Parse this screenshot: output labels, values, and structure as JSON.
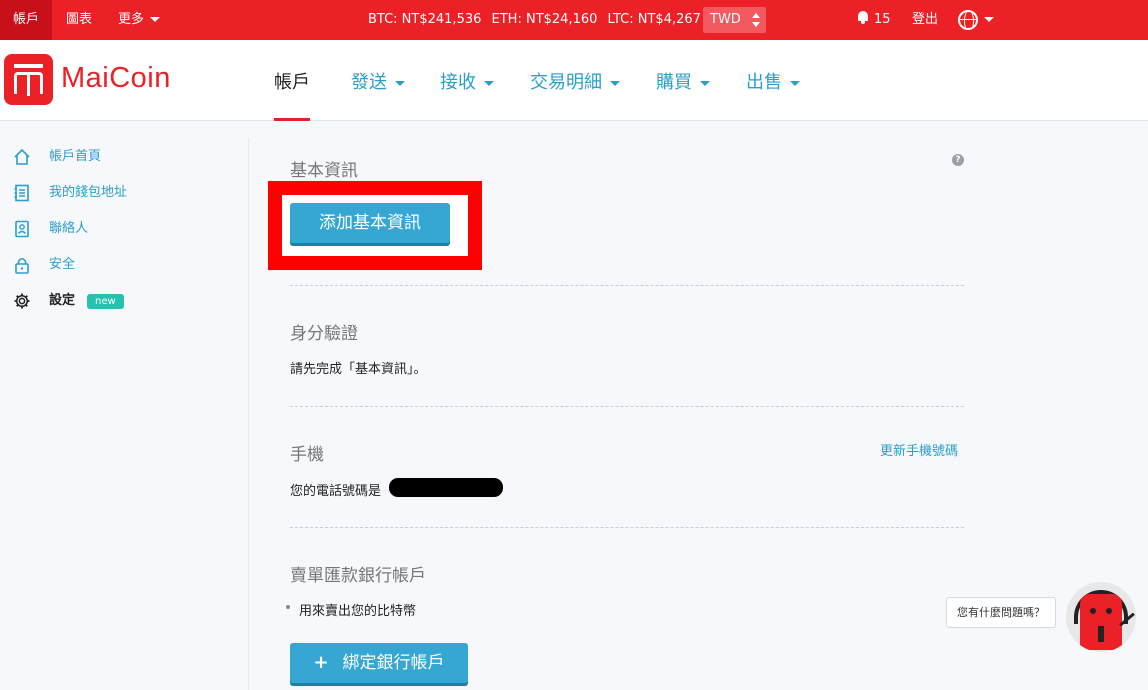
{
  "topbar": {
    "account": "帳戶",
    "chart": "圖表",
    "more": "更多",
    "prices": {
      "btc": "BTC: NT$241,536",
      "eth": "ETH: NT$24,160",
      "ltc": "LTC: NT$4,267"
    },
    "currency": "TWD",
    "notifications": "15",
    "logout": "登出",
    "icons": {
      "bell": "bell-icon",
      "globe": "globe-icon"
    }
  },
  "header": {
    "logo": "MaiCoin",
    "nav": {
      "account": "帳戶",
      "send": "發送",
      "receive": "接收",
      "transactions": "交易明細",
      "buy": "購買",
      "sell": "出售"
    }
  },
  "sidebar": {
    "items": [
      {
        "label": "帳戶首頁",
        "icon": "home-icon"
      },
      {
        "label": "我的錢包地址",
        "icon": "address-book-icon"
      },
      {
        "label": "聯絡人",
        "icon": "contacts-icon"
      },
      {
        "label": "安全",
        "icon": "lock-icon"
      },
      {
        "label": "設定",
        "icon": "gear-icon",
        "badge": "new"
      }
    ]
  },
  "main": {
    "basic_info": {
      "title": "基本資訊",
      "button": "添加基本資訊",
      "help": "?"
    },
    "identity": {
      "title": "身分驗證",
      "text": "請先完成「基本資訊」。"
    },
    "phone": {
      "title": "手機",
      "update_link": "更新手機號碼",
      "text": "您的電話號碼是"
    },
    "bank": {
      "title": "賣單匯款銀行帳戶",
      "bullet": "用來賣出您的比特幣",
      "button": "綁定銀行帳戶",
      "button_icon": "+"
    }
  },
  "chat": {
    "prompt": "您有什麼問題嗎？"
  },
  "colors": {
    "brand": "#ec2027",
    "link": "#2a9fc9",
    "button": "#35a7d2",
    "badge": "#25c2b0"
  }
}
